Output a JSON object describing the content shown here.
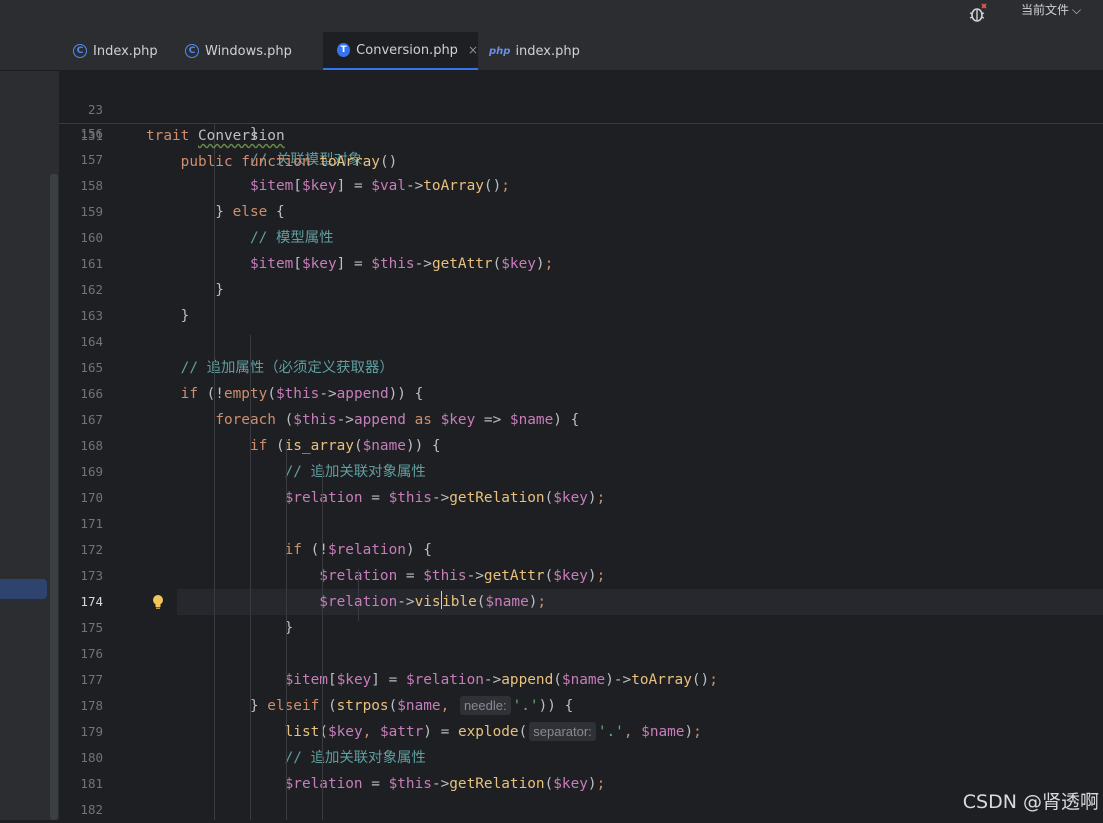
{
  "topbar": {
    "scope_label": "当前文件",
    "scope_chevron": "chevron-down-icon",
    "debug_icon": "bug-icon"
  },
  "tabs": [
    {
      "label": "Index.php",
      "icon": "class-icon",
      "active": false
    },
    {
      "label": "Windows.php",
      "icon": "class-icon",
      "active": false
    },
    {
      "label": "Conversion.php",
      "icon": "trait-icon",
      "active": true,
      "close": "×"
    },
    {
      "label": "index.php",
      "icon": "php-file-icon",
      "active": false
    }
  ],
  "editor": {
    "current_line": 174,
    "sticky": [
      {
        "num": "23",
        "text": "trait Conversion"
      },
      {
        "num": "131",
        "text": "public function toArray()"
      }
    ],
    "lines": [
      {
        "num": "156",
        "text": "}"
      },
      {
        "num": "157",
        "text": "// 关联模型对象"
      },
      {
        "num": "158",
        "text": "$item[$key] = $val->toArray();"
      },
      {
        "num": "159",
        "text": "} else {"
      },
      {
        "num": "160",
        "text": "// 模型属性"
      },
      {
        "num": "161",
        "text": "$item[$key] = $this->getAttr($key);"
      },
      {
        "num": "162",
        "text": "}"
      },
      {
        "num": "163",
        "text": "}"
      },
      {
        "num": "164",
        "text": ""
      },
      {
        "num": "165",
        "text": "// 追加属性（必须定义获取器）"
      },
      {
        "num": "166",
        "text": "if (!empty($this->append)) {"
      },
      {
        "num": "167",
        "text": "foreach ($this->append as $key => $name) {"
      },
      {
        "num": "168",
        "text": "if (is_array($name)) {"
      },
      {
        "num": "169",
        "text": "// 追加关联对象属性"
      },
      {
        "num": "170",
        "text": "$relation = $this->getRelation($key);"
      },
      {
        "num": "171",
        "text": ""
      },
      {
        "num": "172",
        "text": "if (!$relation) {"
      },
      {
        "num": "173",
        "text": "$relation = $this->getAttr($key);"
      },
      {
        "num": "174",
        "text": "$relation->visible($name);"
      },
      {
        "num": "175",
        "text": "}"
      },
      {
        "num": "176",
        "text": ""
      },
      {
        "num": "177",
        "text": "$item[$key] = $relation->append($name)->toArray();"
      },
      {
        "num": "178",
        "text": "} elseif (strpos($name, needle: '.')) {"
      },
      {
        "num": "179",
        "text": "list($key, $attr) = explode( separator: '.', $name);"
      },
      {
        "num": "180",
        "text": "// 追加关联对象属性"
      },
      {
        "num": "181",
        "text": "$relation = $this->getRelation($key);"
      },
      {
        "num": "182",
        "text": ""
      }
    ],
    "hints": {
      "needle": "needle:",
      "separator": "separator:"
    },
    "intention_icon": "lightbulb-icon"
  },
  "watermark": "CSDN @肾透啊",
  "colors": {
    "background": "#1e1f22",
    "keyword": "#cf8e6d",
    "method": "#e8c17d",
    "variable": "#c77dbb",
    "string": "#6aab73",
    "accent": "#3574f0"
  }
}
